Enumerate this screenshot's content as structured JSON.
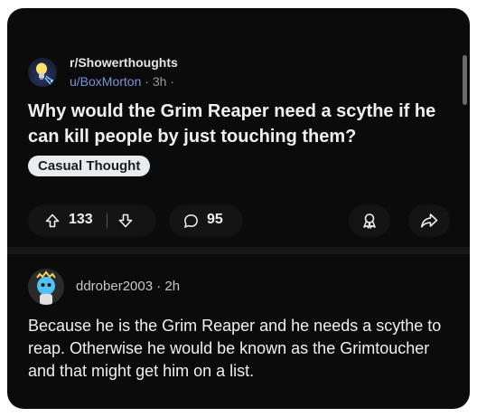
{
  "post": {
    "subreddit": "r/Showerthoughts",
    "author": "u/BoxMorton",
    "age": "3h",
    "separator": "·",
    "title": "Why would the Grim Reaper need a scythe if he can kill people by just touching them?",
    "flair": "Casual Thought",
    "upvotes": "133",
    "comments": "95"
  },
  "comment": {
    "author": "ddrober2003",
    "age": "2h",
    "separator": "·",
    "body": "Because he is the Grim Reaper and he needs a scythe to reap. Otherwise he would be known as the Grimtoucher and that might get him on a list."
  },
  "icons": {
    "upvote": "arrow-up-icon",
    "downvote": "arrow-down-icon",
    "comment": "speech-bubble-icon",
    "award": "award-ribbon-icon",
    "share": "share-arrow-icon"
  },
  "colors": {
    "background": "#0b0b0b",
    "username": "#7d93d8",
    "flair_bg": "#e9ecef"
  }
}
